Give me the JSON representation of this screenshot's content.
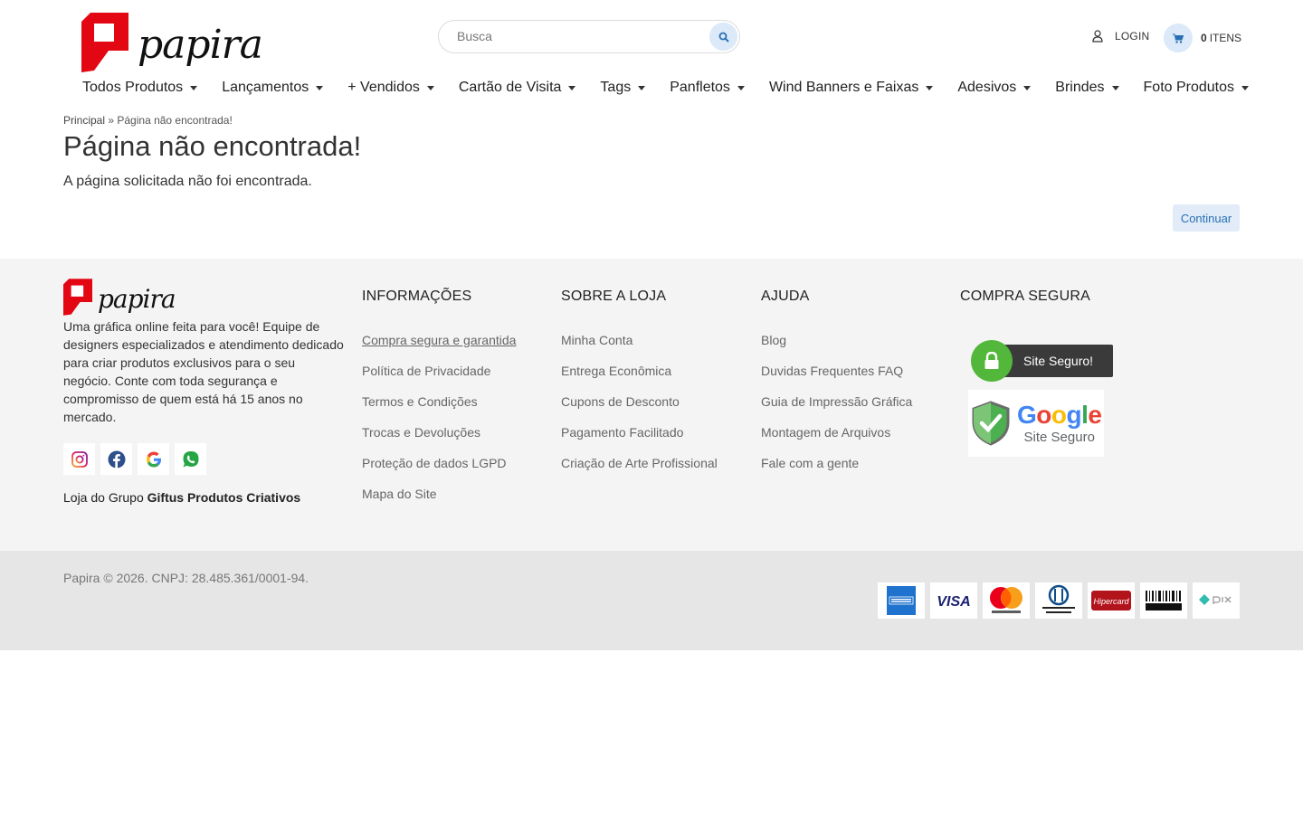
{
  "brand": {
    "name": "papira",
    "color": "#e30613"
  },
  "search": {
    "placeholder": "Busca"
  },
  "header": {
    "login_label": "LOGIN",
    "cart_count": "0",
    "cart_label": "ITENS"
  },
  "nav": [
    {
      "label": "Todos Produtos"
    },
    {
      "label": "Lançamentos"
    },
    {
      "label": "+ Vendidos"
    },
    {
      "label": "Cartão de Visita"
    },
    {
      "label": "Tags"
    },
    {
      "label": "Panfletos"
    },
    {
      "label": "Wind Banners e Faixas"
    },
    {
      "label": "Adesivos"
    },
    {
      "label": "Brindes"
    },
    {
      "label": "Foto Produtos"
    }
  ],
  "breadcrumb": {
    "home": "Principal",
    "separator": " » ",
    "current": "Página não encontrada!"
  },
  "main": {
    "title": "Página não encontrada!",
    "text": "A página solicitada não foi encontrada.",
    "continue_label": "Continuar"
  },
  "footer": {
    "about": "Uma gráfica online feita para você! Equipe de designers especializados e atendimento dedicado para criar produtos exclusivos para o seu negócio. Conte com toda segurança e compromisso de quem está há 15 anos no mercado.",
    "social": [
      "instagram-icon",
      "facebook-icon",
      "google-icon",
      "whatsapp-icon"
    ],
    "group_prefix": "Loja do Grupo ",
    "group_name": "Giftus Produtos Criativos",
    "columns": [
      {
        "title": "INFORMAÇÕES",
        "links": [
          "Compra segura e garantida",
          "Política de Privacidade",
          "Termos e Condições",
          "Trocas e Devoluções",
          "Proteção de dados LGPD",
          "Mapa do Site"
        ]
      },
      {
        "title": "SOBRE A LOJA",
        "links": [
          "Minha Conta",
          "Entrega Econômica",
          "Cupons de Desconto",
          "Pagamento Facilitado",
          "Criação de Arte Profissional"
        ]
      },
      {
        "title": "AJUDA",
        "links": [
          "Blog",
          "Duvidas Frequentes FAQ",
          "Guia de Impressão Gráfica",
          "Montagem de Arquivos",
          "Fale com a gente"
        ]
      },
      {
        "title": "COMPRA SEGURA",
        "links": []
      }
    ],
    "site_seguro": "Site Seguro!",
    "google_badge": {
      "word": "Google",
      "sub": "Site Seguro"
    }
  },
  "bottom": {
    "copyright": "Papira © 2026. CNPJ: 28.485.361/0001-94.",
    "payments": [
      "american-express-icon",
      "visa-icon",
      "mastercard-icon",
      "diners-club-icon",
      "hipercard-icon",
      "boleto-icon",
      "pix-icon"
    ]
  }
}
